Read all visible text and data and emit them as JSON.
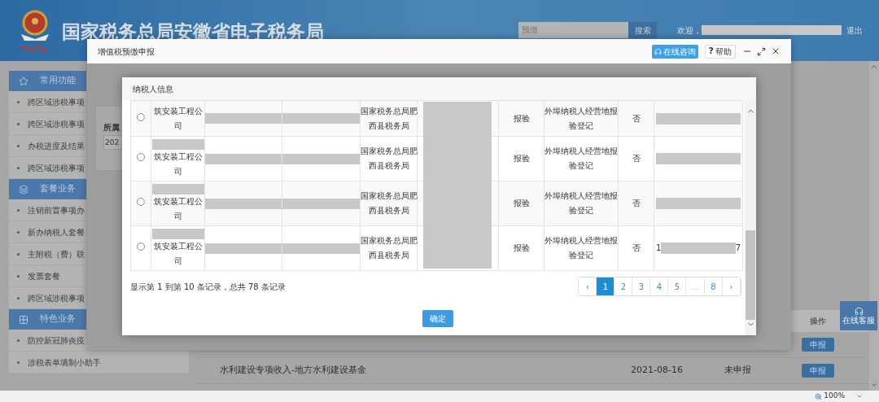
{
  "header": {
    "title": "国家税务总局安徽省电子税务局",
    "search": {
      "value": "预缴"
    },
    "search_button": "搜索",
    "welcome": "欢迎，",
    "logout": "退出"
  },
  "sidebar": [
    {
      "title": "常用功能",
      "items": [
        "跨区域涉税事项",
        "跨区域涉税事项",
        "办税进度及结果",
        "跨区域涉税事项"
      ]
    },
    {
      "title": "套餐业务",
      "items": [
        "注销前置事项办",
        "新办纳税人套餐",
        "主附税（费）联",
        "发票套餐",
        "跨区域涉税事项"
      ]
    },
    {
      "title": "特色业务",
      "items": [
        "防控新冠肺炎疫",
        "涉税表单填制小助手"
      ]
    }
  ],
  "main": {
    "columns": [
      "操作"
    ],
    "rows": [
      {
        "action": "申报"
      },
      {
        "item": "水利建设专项收入-地方水利建设基金",
        "date": "2021-08-16",
        "status": "未申报",
        "action": "申报"
      }
    ]
  },
  "float_service": "在线客服",
  "outer_dialog": {
    "title": "增值税预缴申报",
    "consult": "在线咨询",
    "help": {
      "mark": "?",
      "label": "帮助"
    },
    "form": {
      "label": "所属",
      "value": "202"
    }
  },
  "inner_dialog": {
    "title": "纳税人信息",
    "rows": [
      {
        "selected": false,
        "name": "筑安装工程公司",
        "office": "国家税务总局肥西县税务局",
        "type": "报验",
        "reg": "外埠纳税人经营地报验登记",
        "flag": "否"
      },
      {
        "selected": false,
        "name": "筑安装工程公司",
        "office": "国家税务总局肥西县税务局",
        "type": "报验",
        "reg": "外埠纳税人经营地报验登记",
        "flag": "否"
      },
      {
        "selected": false,
        "name": "筑安装工程公司",
        "office": "国家税务总局肥西县税务局",
        "type": "报验",
        "reg": "外埠纳税人经营地报验登记",
        "flag": "否"
      },
      {
        "selected": false,
        "name": "筑安装工程公司",
        "office": "国家税务总局肥西县税务局",
        "type": "报验",
        "reg": "外埠纳税人经营地报验登记",
        "flag": "否",
        "id_start": "1",
        "id_end": "7"
      }
    ],
    "summary": "显示第 1 到第 10 条记录，总共 78 条记录",
    "pages": [
      {
        "label": "‹",
        "selected": false,
        "disabled": false
      },
      {
        "label": "1",
        "selected": true,
        "disabled": false
      },
      {
        "label": "2",
        "selected": false,
        "disabled": false
      },
      {
        "label": "3",
        "selected": false,
        "disabled": false
      },
      {
        "label": "4",
        "selected": false,
        "disabled": false
      },
      {
        "label": "5",
        "selected": false,
        "disabled": false
      },
      {
        "label": "...",
        "selected": false,
        "disabled": true
      },
      {
        "label": "8",
        "selected": false,
        "disabled": false
      },
      {
        "label": "›",
        "selected": false,
        "disabled": false
      }
    ],
    "confirm": "确定"
  },
  "status_bar": {
    "zoom": "100%"
  }
}
